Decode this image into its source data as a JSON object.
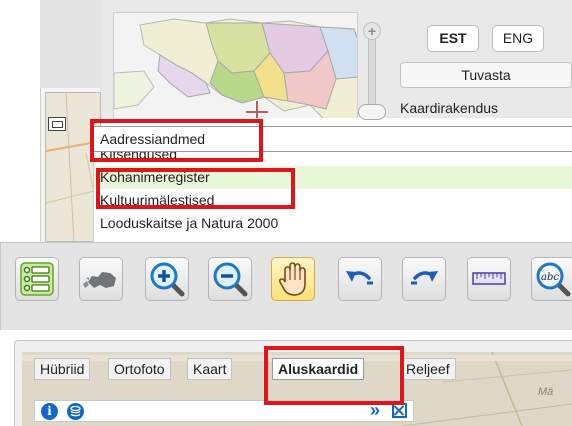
{
  "language": {
    "est_label": "EST",
    "eng_label": "ENG"
  },
  "locate_button": "Tuvasta",
  "app_label": "Kaardirakendus",
  "layer_picker": {
    "selected": "Aadressiandmed",
    "items": [
      {
        "label": "Kitsendused",
        "partial": true
      },
      {
        "label": "Kohanimeregister",
        "highlighted": true
      },
      {
        "label": "Kultuurimälestised"
      },
      {
        "label": "Looduskaitse ja Natura 2000",
        "partial": true
      }
    ]
  },
  "toolbar": {
    "tools": [
      {
        "name": "layer-list-icon"
      },
      {
        "name": "estonia-overview-icon"
      },
      {
        "name": "zoom-in-icon"
      },
      {
        "name": "zoom-out-icon"
      },
      {
        "name": "pan-hand-icon"
      },
      {
        "name": "undo-icon"
      },
      {
        "name": "redo-icon"
      },
      {
        "name": "measure-ruler-icon"
      },
      {
        "name": "text-search-icon"
      }
    ],
    "text_search_icon_label": "abc"
  },
  "basemap_tabs": [
    "Hübriid",
    "Ortofoto",
    "Kaart",
    "Aluskaardid",
    "Reljeef"
  ],
  "active_basemap_tab": "Aluskaardid",
  "info_bar": {
    "info_icon": "i",
    "chevrons": "»"
  },
  "map_corner_label": "Mä",
  "colors": {
    "highlight_red": "#e0151b",
    "selected_item_green": "#e8f7d9",
    "icon_blue": "#1467c8"
  }
}
